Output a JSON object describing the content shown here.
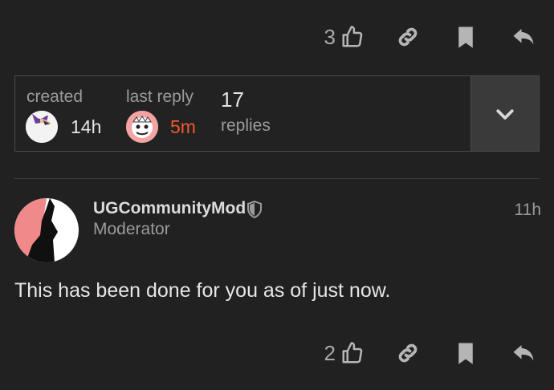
{
  "first_post_actions": {
    "like_count": "3"
  },
  "topic_map": {
    "created_label": "created",
    "created_time": "14h",
    "last_reply_label": "last reply",
    "last_reply_time": "5m",
    "replies_count": "17",
    "replies_label": "replies"
  },
  "post": {
    "username": "UGCommunityMod",
    "user_title": "Moderator",
    "date": "11h",
    "body": "This has been done for you as of just now.",
    "like_count": "2"
  },
  "colors": {
    "background": "#212121",
    "accent_recent": "#f1592a",
    "muted_text": "#9b9b9b",
    "icon": "#b5b5b5"
  },
  "icons": [
    "thumbs-up-icon",
    "link-icon",
    "bookmark-icon",
    "reply-icon",
    "chevron-down-icon",
    "shield-icon"
  ]
}
